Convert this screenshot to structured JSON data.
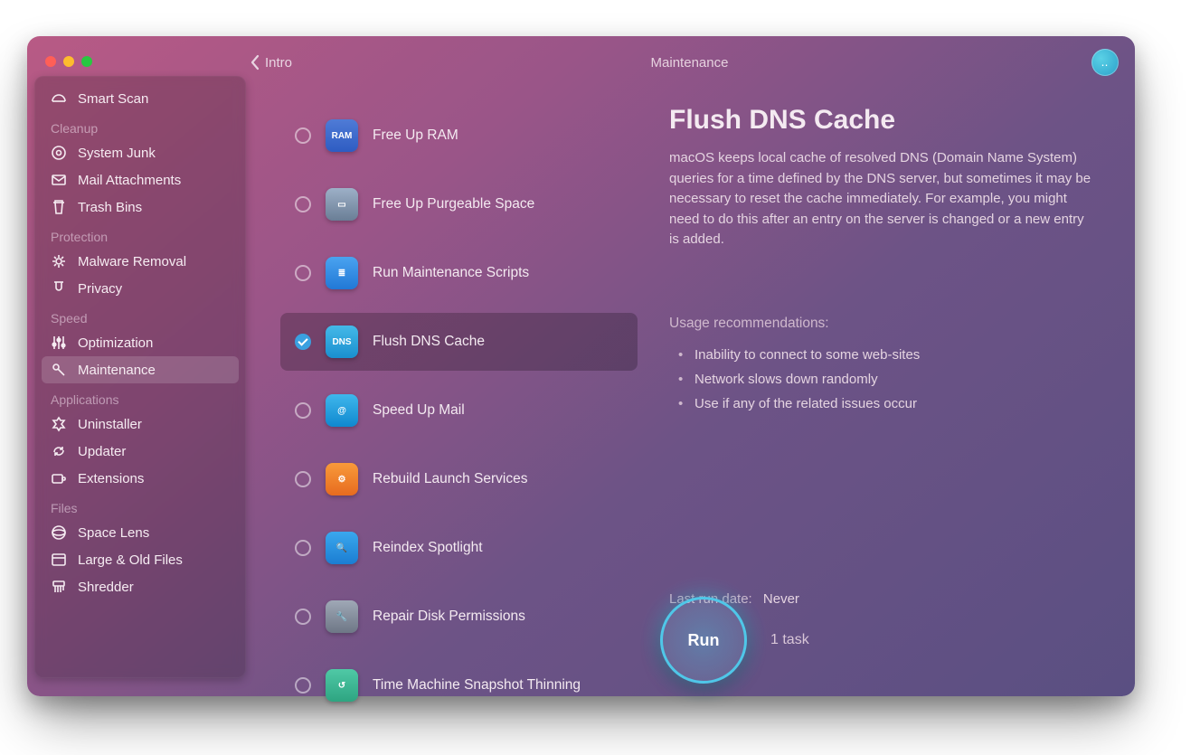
{
  "header": {
    "back_label": "Intro",
    "title": "Maintenance"
  },
  "sidebar": {
    "top": {
      "label": "Smart Scan"
    },
    "sections": [
      {
        "title": "Cleanup",
        "items": [
          "System Junk",
          "Mail Attachments",
          "Trash Bins"
        ]
      },
      {
        "title": "Protection",
        "items": [
          "Malware Removal",
          "Privacy"
        ]
      },
      {
        "title": "Speed",
        "items": [
          "Optimization",
          "Maintenance"
        ]
      },
      {
        "title": "Applications",
        "items": [
          "Uninstaller",
          "Updater",
          "Extensions"
        ]
      },
      {
        "title": "Files",
        "items": [
          "Space Lens",
          "Large & Old Files",
          "Shredder"
        ]
      }
    ],
    "active": "Maintenance"
  },
  "tasks": [
    {
      "label": "Free Up RAM",
      "icon": "i-ram",
      "glyph": "RAM",
      "checked": false
    },
    {
      "label": "Free Up Purgeable Space",
      "icon": "i-purge",
      "glyph": "▭",
      "checked": false
    },
    {
      "label": "Run Maintenance Scripts",
      "icon": "i-scripts",
      "glyph": "≣",
      "checked": false
    },
    {
      "label": "Flush DNS Cache",
      "icon": "i-dns",
      "glyph": "DNS",
      "checked": true
    },
    {
      "label": "Speed Up Mail",
      "icon": "i-mail",
      "glyph": "@",
      "checked": false
    },
    {
      "label": "Rebuild Launch Services",
      "icon": "i-launch",
      "glyph": "⚙",
      "checked": false
    },
    {
      "label": "Reindex Spotlight",
      "icon": "i-spot",
      "glyph": "🔍",
      "checked": false
    },
    {
      "label": "Repair Disk Permissions",
      "icon": "i-repair",
      "glyph": "🔧",
      "checked": false
    },
    {
      "label": "Time Machine Snapshot Thinning",
      "icon": "i-tm",
      "glyph": "↺",
      "checked": false
    }
  ],
  "detail": {
    "title": "Flush DNS Cache",
    "description": "macOS keeps local cache of resolved DNS (Domain Name System) queries for a time defined by the DNS server, but sometimes it may be necessary to reset the cache immediately. For example, you might need to do this after an entry on the server is changed or a new entry is added.",
    "usage_heading": "Usage recommendations:",
    "usage": [
      "Inability to connect to some web-sites",
      "Network slows down randomly",
      "Use if any of the related issues occur"
    ],
    "last_run_label": "Last run date:",
    "last_run_value": "Never"
  },
  "run": {
    "button": "Run",
    "count": "1 task"
  },
  "sidebar_icons": {
    "Smart Scan": "<path d='M2 12a7 7 0 0 1 14 0'/><path d='M2 12h14'/>",
    "System Junk": "<circle cx='9' cy='9' r='7'/><circle cx='9' cy='9' r='2.5'/>",
    "Mail Attachments": "<rect x='2' y='4' width='14' height='10' rx='1'/><path d='M2 5l7 5 7-5'/>",
    "Trash Bins": "<path d='M5 4V2h8v2'/><path d='M3 4h12'/><path d='M5 4l1 12h6l1-12'/>",
    "Malware Removal": "<circle cx='9' cy='9' r='3'/><path d='M9 2v3M9 13v3M2 9h3M13 9h3M4 4l2 2M12 12l2 2M14 4l-2 2M6 12l-2 2'/>",
    "Privacy": "<path d='M6 2v6a3 3 0 0 0 6 0V2'/><path d='M4 2h10'/>",
    "Optimization": "<path d='M4 2v14M9 2v14M14 2v14'/><circle cx='4' cy='11' r='1.8' fill='currentColor'/><circle cx='9' cy='6' r='1.8' fill='currentColor'/><circle cx='14' cy='12' r='1.8' fill='currentColor'/>",
    "Maintenance": "<circle cx='6' cy='6' r='3'/><path d='M8 8l7 7'/>",
    "Uninstaller": "<path d='M9 2l2 3h4l-3 4 3 4h-4l-2 3-2-3H3l3-4-3-4h4z'/>",
    "Updater": "<path d='M4 10a5 5 0 0 1 9-3'/><path d='M13 4v3h-3'/><path d='M14 8a5 5 0 0 1-9 3'/><path d='M5 14v-3h3'/>",
    "Extensions": "<rect x='2' y='5' width='11' height='9' rx='1.5'/><rect x='13' y='8' width='3' height='3' rx='1'/>",
    "Space Lens": "<circle cx='9' cy='9' r='7'/><ellipse cx='9' cy='9' rx='7' ry='3'/>",
    "Large & Old Files": "<rect x='2' y='3' width='14' height='12' rx='1.5'/><path d='M2 7h14'/>",
    "Shredder": "<rect x='3' y='3' width='12' height='5' rx='1'/><path d='M5 8v7M8 8v7M11 8v7M14 8v5'/>"
  }
}
